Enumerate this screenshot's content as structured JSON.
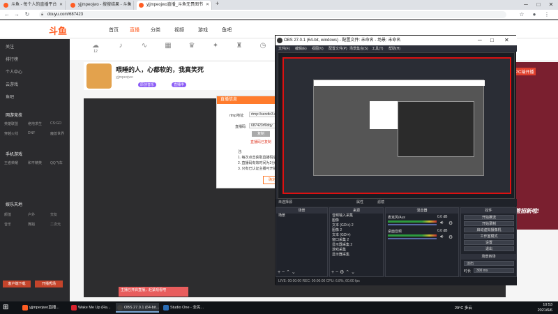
{
  "browser": {
    "tabs": [
      {
        "label": "斗鱼 - 每个人的直播平台",
        "color": "#ff5d23"
      },
      {
        "label": "yjjmpeojwo - 搜搜结果 - 斗鱼",
        "color": "#ff5d23"
      },
      {
        "label": "yjjmpeojwo直播_斗鱼无畏图书",
        "color": "#ff5d23"
      }
    ],
    "new_tab": "+",
    "url": "douyu.com/687423",
    "back": "←",
    "forward": "→",
    "reload": "↻",
    "minimize": "─",
    "maximize": "□",
    "close": "✕"
  },
  "douyu": {
    "logo": "斗鱼",
    "nav": [
      "首页",
      "直播",
      "分类",
      "视频",
      "游戏",
      "鱼吧"
    ],
    "second_icons": [
      {
        "label": "12",
        "glyph": "☁"
      },
      {
        "label": "",
        "glyph": "♪"
      },
      {
        "label": "",
        "glyph": "∿"
      },
      {
        "label": "",
        "glyph": "▦"
      },
      {
        "label": "",
        "glyph": "♛"
      },
      {
        "label": "",
        "glyph": "✦"
      },
      {
        "label": "",
        "glyph": "♜"
      },
      {
        "label": "",
        "glyph": "◷"
      }
    ],
    "sidebar": {
      "items": [
        "关注",
        "排行榜",
        "个人中心",
        "云游戏",
        "鱼吧"
      ],
      "sections": [
        "网游竞技",
        "手机游戏",
        "娱乐天地"
      ],
      "cats": [
        [
          "英雄联盟",
          "绝地求生",
          "CS:GO"
        ],
        [
          "穿越火线",
          "DNF",
          "魔兽世界"
        ],
        [
          "王者荣耀",
          "和平精英",
          "QQ飞车"
        ],
        [
          "颜值",
          "户外",
          "交友"
        ],
        [
          "音乐",
          "舞蹈",
          "二次元"
        ]
      ],
      "btn_left": "客户端下载",
      "btn_right": "开播秀场"
    },
    "streamer": {
      "title": "喂睡的人，心都软的，我真笑死",
      "name": "yjjmpeojwo",
      "tags": [
        "原创音乐",
        "直播中"
      ]
    },
    "bottom_notice": "主播已开启直播，赶紧观看吧",
    "banner_text": "PC端开播",
    "promo": "房管招新啦!"
  },
  "modal": {
    "title": "直播信息",
    "rtmp_label": "rtmp地址:",
    "rtmp_value": "rtmp://sendtc3.douyu.com/live",
    "key_label": "直播码:",
    "key_value": "687423rf0dqy",
    "copy_btn": "复制",
    "hint": "直播码已复制",
    "notes_title": "注:",
    "notes": [
      "1. 每次点击获取直播码后",
      "2. 直播码有效时间为2分钟",
      "3. 只有已认证主播可开播"
    ],
    "ok": "确定"
  },
  "obs": {
    "title": "OBS 27.0.1 (64-bit, windows) - 配置文件: 未命名 - 场景: 未命名",
    "menu": [
      "文件(F)",
      "编辑(E)",
      "视图(V)",
      "配置文件(P)",
      "场景集合(S)",
      "工具(T)",
      "帮助(H)"
    ],
    "scene_bar": "未选择源",
    "scene_props": "属性",
    "scene_filter": "滤镜",
    "docks": {
      "scenes": {
        "title": "场景",
        "items": [
          "场景"
        ]
      },
      "sources": {
        "title": "来源",
        "items": [
          "音频输入采集",
          "图像",
          "文本 (GDI+) 2",
          "图像 2",
          "文本 (GDI+)",
          "窗口采集 2",
          "显示器采集 2",
          "游戏采集",
          "显示器采集"
        ]
      },
      "mixer": {
        "title": "混音器",
        "ch1": "麦克风/Aux",
        "ch2": "桌面音频",
        "db1": "0.0 dB",
        "db2": "0.0 dB"
      },
      "controls": {
        "title": "控件",
        "buttons": [
          "开始推流",
          "开始录制",
          "启动虚拟摄像机",
          "工作室模式",
          "设置",
          "退出"
        ]
      },
      "transitions": {
        "title": "场景转场",
        "type": "淡出",
        "duration_label": "时长",
        "duration": "300 ms"
      }
    },
    "status": "LIVE: 00:00:00   REC: 00:00:00   CPU: 6.8%, 60.00 fps"
  },
  "taskbar": {
    "apps": [
      {
        "label": "yjjmpeojwo直播...",
        "color": "#ff5d23",
        "active": false
      },
      {
        "label": "Wake Me Up (Ra...",
        "color": "#d9232d",
        "active": false
      },
      {
        "label": "OBS 27.0.1 (64-bit...",
        "color": "#3d3d3d",
        "active": true
      },
      {
        "label": "Studio One - 全民...",
        "color": "#2a6db5",
        "active": false
      }
    ],
    "weather": "29°C 多云",
    "time": "10:53",
    "date": "2021/6/6"
  }
}
